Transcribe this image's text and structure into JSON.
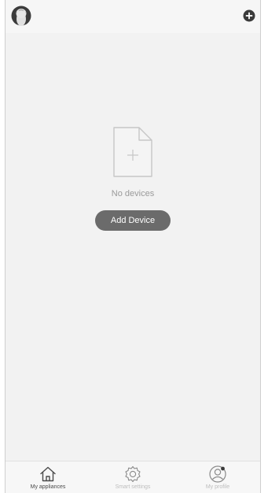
{
  "header": {
    "avatar_icon": "user-avatar-icon",
    "add_icon": "add-circle-icon"
  },
  "empty_state": {
    "icon": "blank-file-plus-icon",
    "message": "No devices",
    "button_label": "Add Device"
  },
  "tabs": [
    {
      "label": "My appliances",
      "icon": "home-icon",
      "active": true
    },
    {
      "label": "Smart settings",
      "icon": "gear-icon",
      "active": false
    },
    {
      "label": "My profile",
      "icon": "profile-icon",
      "active": false
    }
  ],
  "colors": {
    "background": "#f2f2f2",
    "button": "#6b6b6b",
    "active_tab_text": "#4a4a4a",
    "inactive_tab_text": "#bdbdbd"
  }
}
